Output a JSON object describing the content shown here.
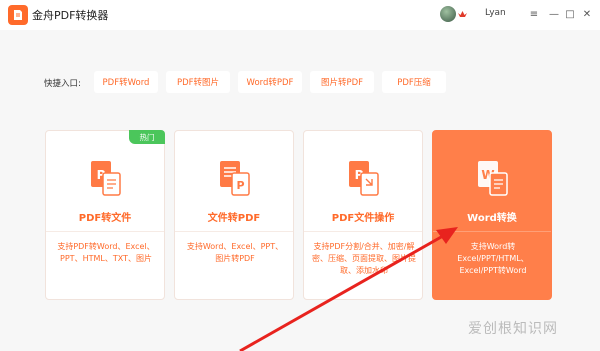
{
  "app": {
    "title": "金舟PDF转换器"
  },
  "user": {
    "name": "Lyan"
  },
  "window_controls": {
    "menu": "≡",
    "minimize": "—",
    "maximize": "□",
    "close": "✕"
  },
  "quick": {
    "label": "快捷入口:",
    "buttons": [
      "PDF转Word",
      "PDF转图片",
      "Word转PDF",
      "图片转PDF",
      "PDF压缩"
    ]
  },
  "cards": [
    {
      "title": "PDF转文件",
      "desc": "支持PDF转Word、Excel、PPT、HTML、TXT、图片",
      "badge": "热门",
      "icon": "pdf-to-file-icon"
    },
    {
      "title": "文件转PDF",
      "desc": "支持Word、Excel、PPT、图片转PDF",
      "icon": "file-to-pdf-icon"
    },
    {
      "title": "PDF文件操作",
      "desc": "支持PDF分割/合并、加密/解密、压缩、页面提取、图片提取、添加水印",
      "icon": "pdf-operations-icon"
    },
    {
      "title": "Word转换",
      "desc": "支持Word转Excel/PPT/HTML、Excel/PPT转Word",
      "icon": "word-convert-icon"
    }
  ],
  "watermark": "爱创根知识网",
  "colors": {
    "accent": "#ff6a2a",
    "active_card": "#ff7f4a",
    "badge": "#4bc65b",
    "arrow": "#e8231e"
  }
}
